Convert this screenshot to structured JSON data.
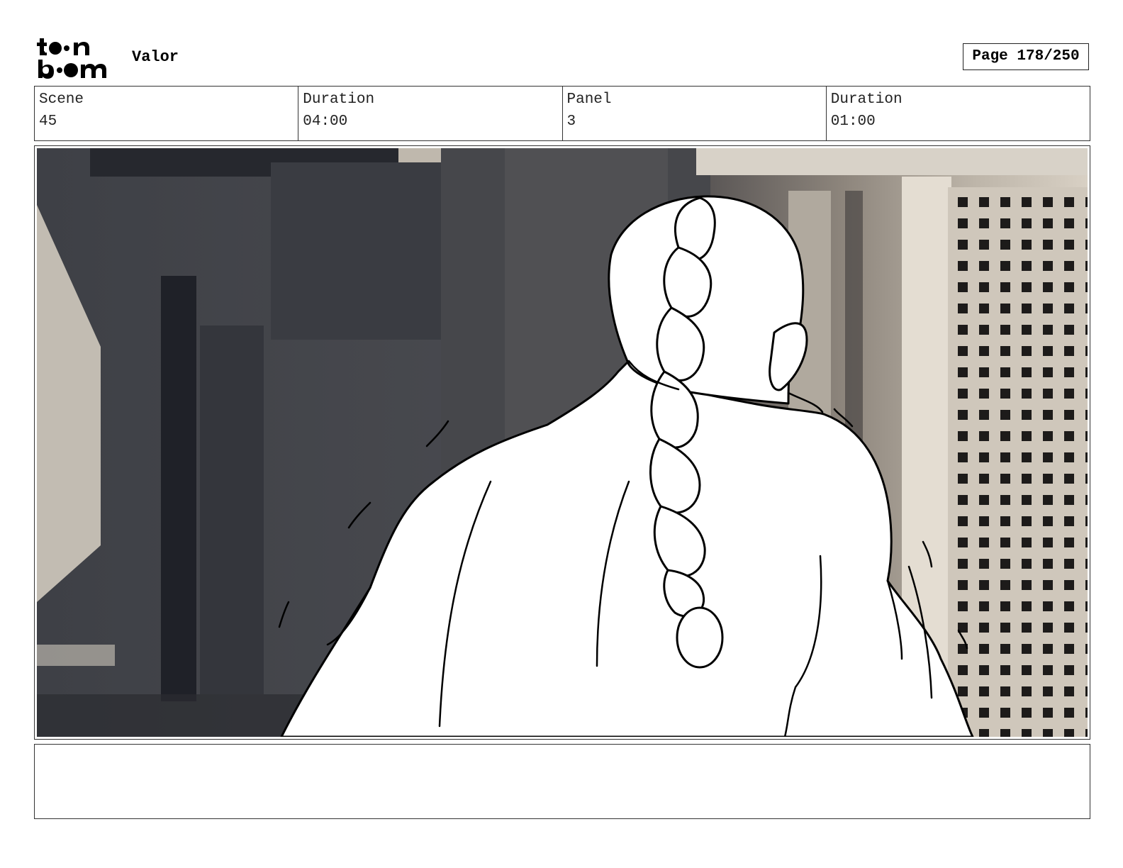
{
  "header": {
    "logo_text": "toonboom",
    "project_title": "Valor",
    "page_label": "Page 178/250"
  },
  "info": [
    {
      "label": "Scene",
      "value": "45"
    },
    {
      "label": "Duration",
      "value": "04:00"
    },
    {
      "label": "Panel",
      "value": "3"
    },
    {
      "label": "Duration",
      "value": "01:00"
    }
  ],
  "panel": {
    "description": "",
    "notes": ""
  }
}
